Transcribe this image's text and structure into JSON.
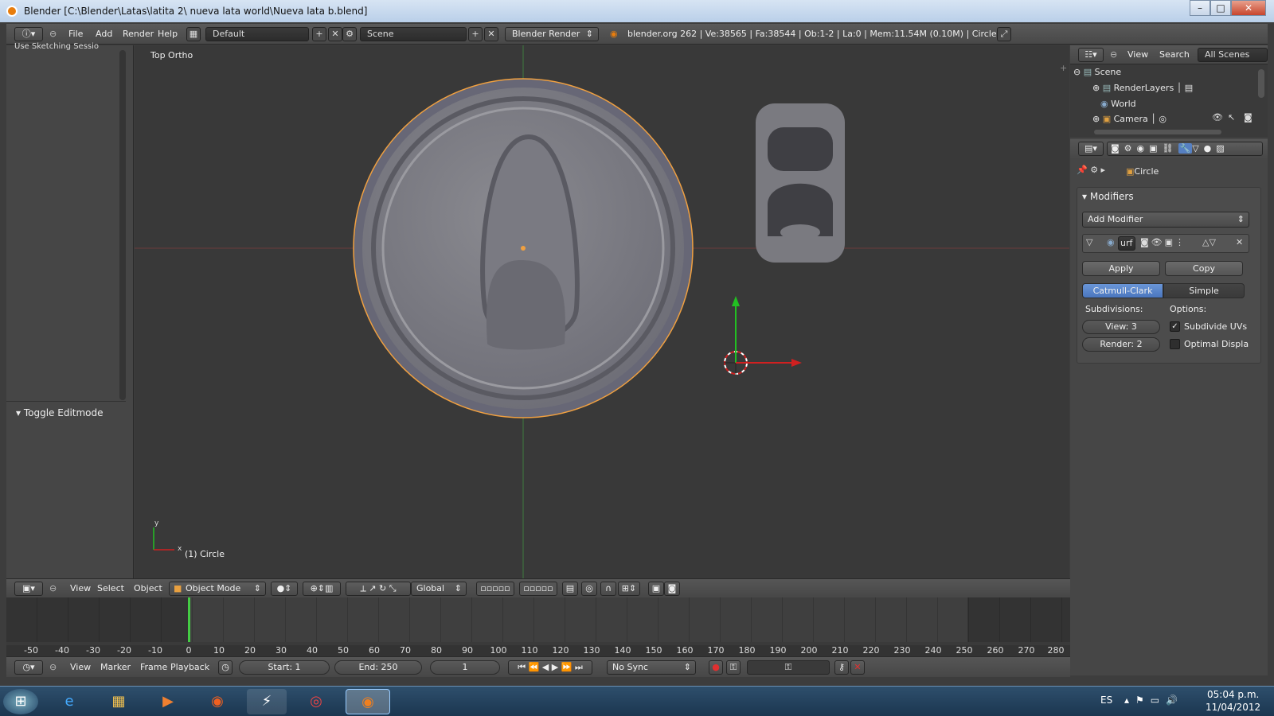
{
  "window": {
    "title": "Blender  [C:\\Blender\\Latas\\latita 2\\ nueva lata world\\Nueva lata b.blend]"
  },
  "topbar": {
    "menus": [
      "File",
      "Add",
      "Render",
      "Help"
    ],
    "layout": "Default",
    "scene": "Scene",
    "engine": "Blender Render",
    "stats": "blender.org 262 | Ve:38565 | Fa:38544 | Ob:1-2 | La:0 | Mem:11.54M (0.10M) | Circle"
  },
  "left_panel": {
    "sketch": "Use Sketching Sessio",
    "toggle": "Toggle Editmode"
  },
  "viewport": {
    "label": "Top Ortho",
    "object": "(1) Circle",
    "axis_y": "y",
    "axis_x": "x"
  },
  "view3d_header": {
    "menus": [
      "View",
      "Select",
      "Object"
    ],
    "mode": "Object Mode",
    "orientation": "Global"
  },
  "timeline": {
    "ticks": [
      "-50",
      "-40",
      "-30",
      "-20",
      "-10",
      "0",
      "10",
      "20",
      "30",
      "40",
      "50",
      "60",
      "70",
      "80",
      "90",
      "100",
      "110",
      "120",
      "130",
      "140",
      "150",
      "160",
      "170",
      "180",
      "190",
      "200",
      "210",
      "220",
      "230",
      "240",
      "250",
      "260",
      "270",
      "280"
    ],
    "current_frame_marker": 0,
    "menus": [
      "View",
      "Marker",
      "Frame",
      "Playback"
    ],
    "start": "Start: 1",
    "end": "End: 250",
    "current": "1",
    "sync": "No Sync"
  },
  "outliner": {
    "menus": [
      "View",
      "Search"
    ],
    "filter": "All Scenes",
    "items": [
      "Scene",
      "RenderLayers",
      "World",
      "Camera"
    ]
  },
  "properties": {
    "object": "Circle",
    "section": "Modifiers",
    "add_modifier": "Add Modifier",
    "modifier_name": "urf",
    "apply": "Apply",
    "copy": "Copy",
    "catmull": "Catmull-Clark",
    "simple": "Simple",
    "subdivisions_label": "Subdivisions:",
    "options_label": "Options:",
    "view": "View: 3",
    "render": "Render: 2",
    "subdivide_uvs": "Subdivide UVs",
    "optimal": "Optimal Displa"
  },
  "taskbar": {
    "lang": "ES",
    "time": "05:04 p.m.",
    "date": "11/04/2012"
  }
}
